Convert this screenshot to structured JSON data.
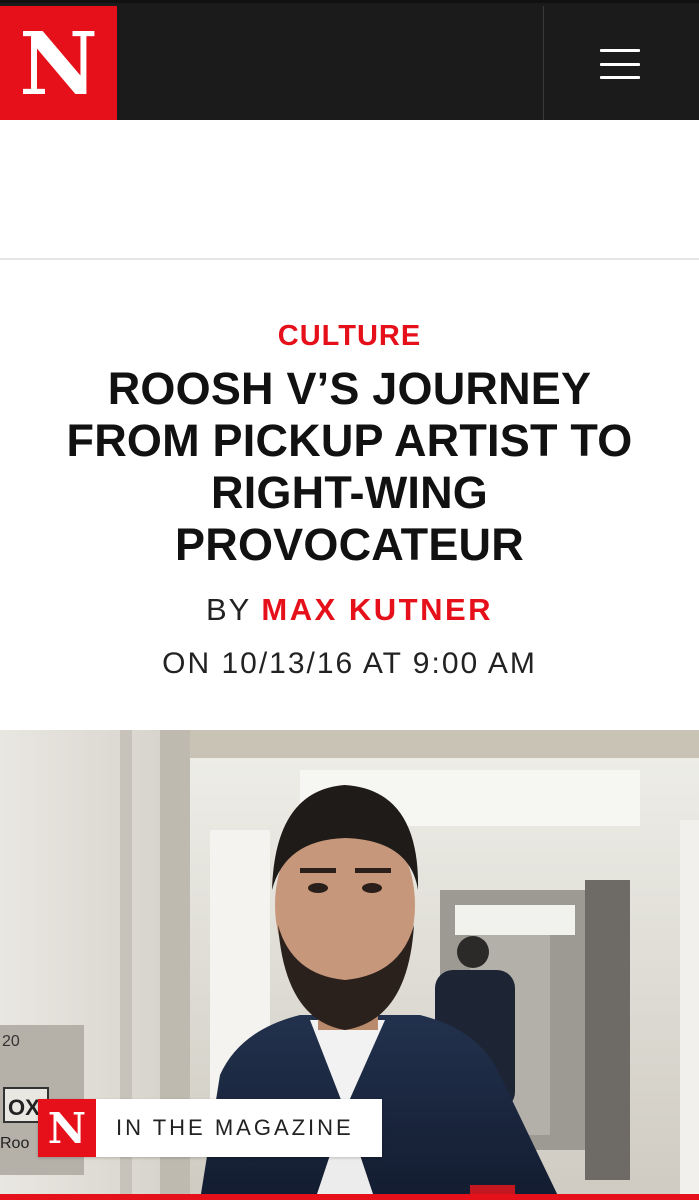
{
  "header": {
    "logo_letter": "N",
    "menu_icon": "hamburger-menu-icon",
    "brand_color": "#e6101a"
  },
  "article": {
    "category": "CULTURE",
    "headline": "ROOSH V’S JOURNEY FROM PICKUP ARTIST TO RIGHT-WING PROVOCATEUR",
    "byline_prefix": "BY",
    "author": "MAX KUTNER",
    "dateline": "ON 10/13/16 AT 9:00 AM"
  },
  "hero": {
    "tag_logo_letter": "N",
    "tag_label": "IN THE MAGAZINE",
    "sign_number": "20",
    "sign_text_1": "OX",
    "sign_text_2": "Roo"
  }
}
